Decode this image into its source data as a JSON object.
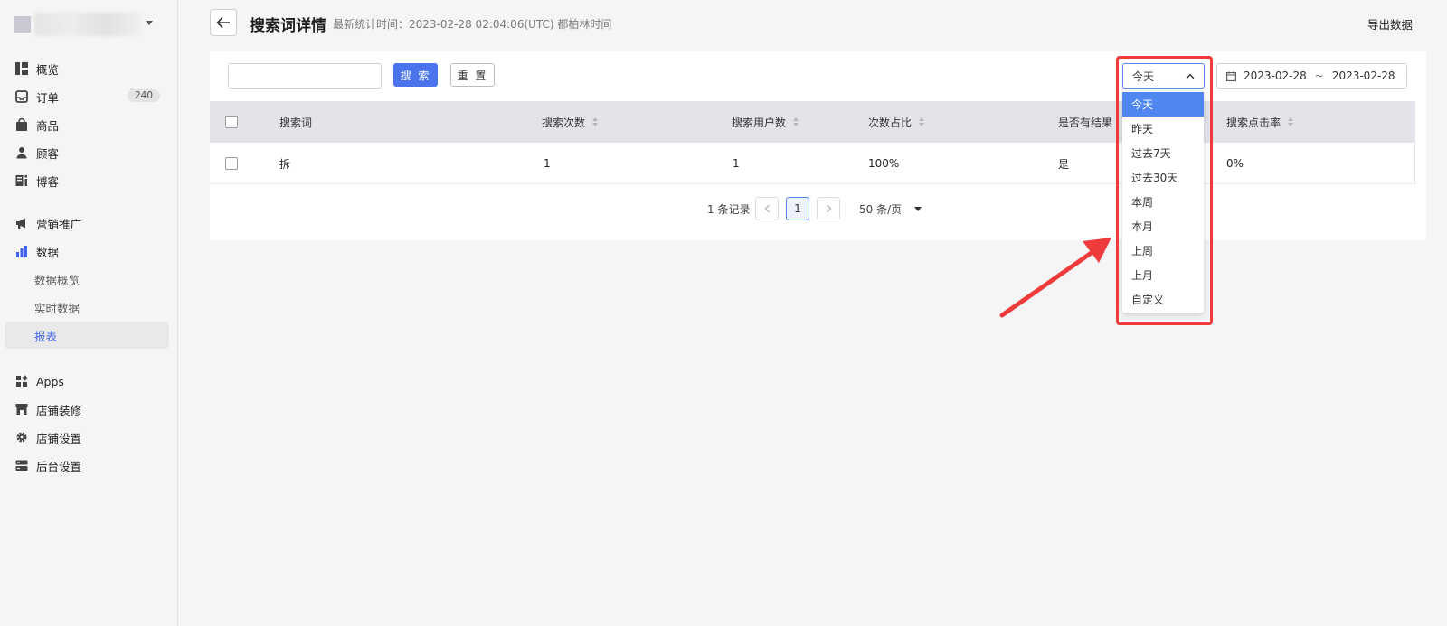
{
  "sidebar": {
    "store_name": "",
    "items": [
      {
        "label": "概览",
        "icon": "dashboard-icon"
      },
      {
        "label": "订单",
        "icon": "inbox-icon",
        "badge": "240"
      },
      {
        "label": "商品",
        "icon": "bag-icon"
      },
      {
        "label": "顾客",
        "icon": "person-icon"
      },
      {
        "label": "博客",
        "icon": "blog-icon"
      },
      {
        "label": "营销推广",
        "icon": "megaphone-icon"
      },
      {
        "label": "数据",
        "icon": "bar-chart-icon"
      },
      {
        "label": "数据概览"
      },
      {
        "label": "实时数据"
      },
      {
        "label": "报表",
        "active": true
      },
      {
        "label": "Apps",
        "icon": "apps-icon"
      },
      {
        "label": "店铺装修",
        "icon": "storefront-icon"
      },
      {
        "label": "店铺设置",
        "icon": "gear-icon"
      },
      {
        "label": "后台设置",
        "icon": "server-icon"
      }
    ]
  },
  "header": {
    "title": "搜索词详情",
    "stat_time": "最新统计时间：2023-02-28 02:04:06(UTC) 都柏林时间",
    "export_label": "导出数据"
  },
  "toolbar": {
    "search_value": "",
    "search_label": "搜 索",
    "reset_label": "重 置",
    "range_value": "今天",
    "date_start": "2023-02-28",
    "date_sep": "~",
    "date_end": "2023-02-28"
  },
  "table": {
    "columns": [
      "搜索词",
      "搜索次数",
      "搜索用户数",
      "次数占比",
      "是否有结果",
      "搜索点击率"
    ],
    "rows": [
      {
        "term": "拆",
        "count": "1",
        "users": "1",
        "ratio": "100%",
        "has_result": "是",
        "ctr": "0%"
      }
    ]
  },
  "pagination": {
    "total": "1 条记录",
    "current_page": "1",
    "page_size": "50 条/页"
  },
  "dropdown": {
    "options": [
      "今天",
      "昨天",
      "过去7天",
      "过去30天",
      "本周",
      "本月",
      "上周",
      "上月",
      "自定义"
    ],
    "selected_index": 0
  },
  "colors": {
    "primary": "#4a73ec",
    "active_nav": "#3f63e8",
    "dropdown_selected": "#4f86f0",
    "annotation": "#ef3b3b",
    "table_header": "#e3e4e9"
  }
}
